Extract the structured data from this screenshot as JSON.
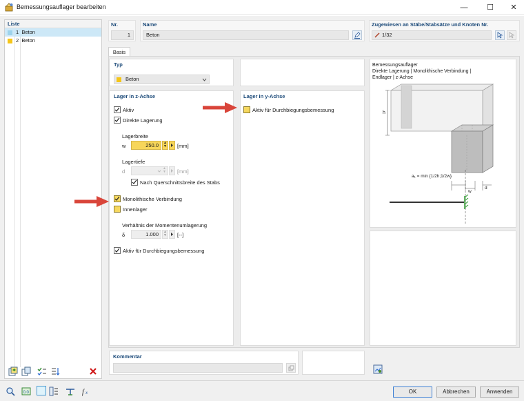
{
  "window": {
    "title": "Bemessungsauflager bearbeiten"
  },
  "list": {
    "header": "Liste",
    "items": [
      {
        "num": "1",
        "name": "Beton",
        "color": "#9ed3ec",
        "selected": true
      },
      {
        "num": "2",
        "name": "Beton",
        "color": "#f5c518",
        "selected": false
      }
    ]
  },
  "nr": {
    "label": "Nr.",
    "value": "1"
  },
  "name": {
    "label": "Name",
    "value": "Beton"
  },
  "assigned": {
    "label": "Zugewiesen an Stäbe/Stabsätze und Knoten Nr.",
    "value": "1/32"
  },
  "tabs": [
    "Basis"
  ],
  "typ": {
    "label": "Typ",
    "value": "Beton",
    "color": "#f5c518"
  },
  "z_axis": {
    "header": "Lager in z-Achse",
    "aktiv": "Aktiv",
    "direkte_lagerung": "Direkte Lagerung",
    "lagerbreite_label": "Lagerbreite",
    "w_symbol": "w",
    "w_value": "250.0",
    "w_unit": "[mm]",
    "lagertiefe_label": "Lagertiefe",
    "d_symbol": "d",
    "d_unit": "[mm]",
    "nach_querschnitt": "Nach Querschnittsbreite des Stabs",
    "monolithisch": "Monolithische Verbindung",
    "innenlager": "Innenlager",
    "verhaeltnis_label": "Verhältnis der Momentenumlagerung",
    "delta_symbol": "δ",
    "delta_value": "1.000",
    "delta_unit": "[--]",
    "durchbiegung": "Aktiv für Durchbiegungsbemessung"
  },
  "y_axis": {
    "header": "Lager in y-Achse",
    "durchbiegung": "Aktiv für Durchbiegungsbemessung"
  },
  "info": {
    "line1": "Bemessungsauflager",
    "line2": "Direkte Lagerung | Monolithische Verbindung |",
    "line3": "Endlager | z-Achse",
    "h": "h",
    "formula": "a₁ = min {1/2h;1/2w}",
    "w": "w",
    "d": "d"
  },
  "kommentar": {
    "label": "Kommentar",
    "value": ""
  },
  "buttons": {
    "ok": "OK",
    "abbrechen": "Abbrechen",
    "anwenden": "Anwenden"
  }
}
